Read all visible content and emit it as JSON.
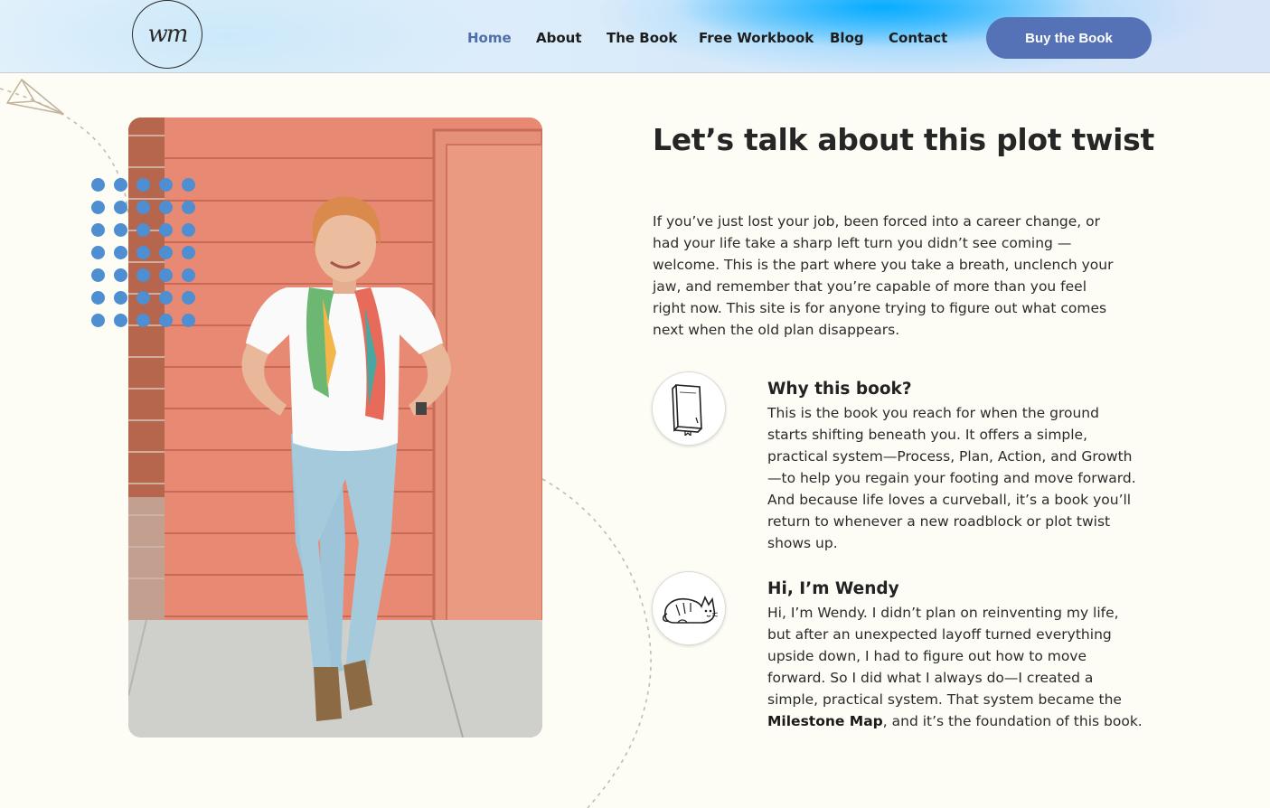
{
  "header": {
    "logo_text": "wm",
    "nav": [
      {
        "label": "Home",
        "active": true
      },
      {
        "label": "About",
        "active": false
      },
      {
        "label": "The Book",
        "active": false
      },
      {
        "label": "Free Workbook",
        "active": false
      },
      {
        "label": "Blog",
        "active": false
      },
      {
        "label": "Contact",
        "active": false
      }
    ],
    "cta_label": "Buy the Book"
  },
  "icons": {
    "paper_plane": "paper-plane-icon",
    "book": "book-icon",
    "cat": "cat-icon"
  },
  "colors": {
    "accent": "#5572b6",
    "nav_active": "#4f6fa8",
    "dots": "#4e8ed1",
    "background": "#fdfdf6"
  },
  "main": {
    "title": "Let’s talk about this plot twist",
    "intro_lines": [
      "If you’ve just lost your job, been forced into a career change, or",
      "had your life take a sharp left turn you didn’t see coming —",
      "welcome. This is the part where you take a breath, unclench your",
      "jaw, and remember that you’re capable of more than you feel",
      "right now. This site is for anyone trying to figure out what comes",
      "next when the old plan disappears."
    ],
    "features": [
      {
        "heading": "Why this book?",
        "lines": [
          "This is the book you reach for when the ground",
          "starts shifting beneath you. It offers a simple,",
          "practical system—Process, Plan, Action, and Growth",
          "—to help you regain your footing and move forward.",
          "And because life loves a curveball, it’s a book you’ll",
          "return to whenever a new roadblock or plot twist",
          "shows up."
        ]
      },
      {
        "heading": "Hi, I’m Wendy",
        "lines": [
          "Hi, I’m Wendy. I didn’t plan on reinventing my life,",
          "but after an unexpected layoff turned everything",
          "upside down, I had to figure out how to move",
          "forward. So I did what I always do—I created a",
          "simple, practical system. That system became the"
        ],
        "last_line_bold": "Milestone Map",
        "last_line_rest": ", and it’s the foundation of this book."
      }
    ]
  }
}
